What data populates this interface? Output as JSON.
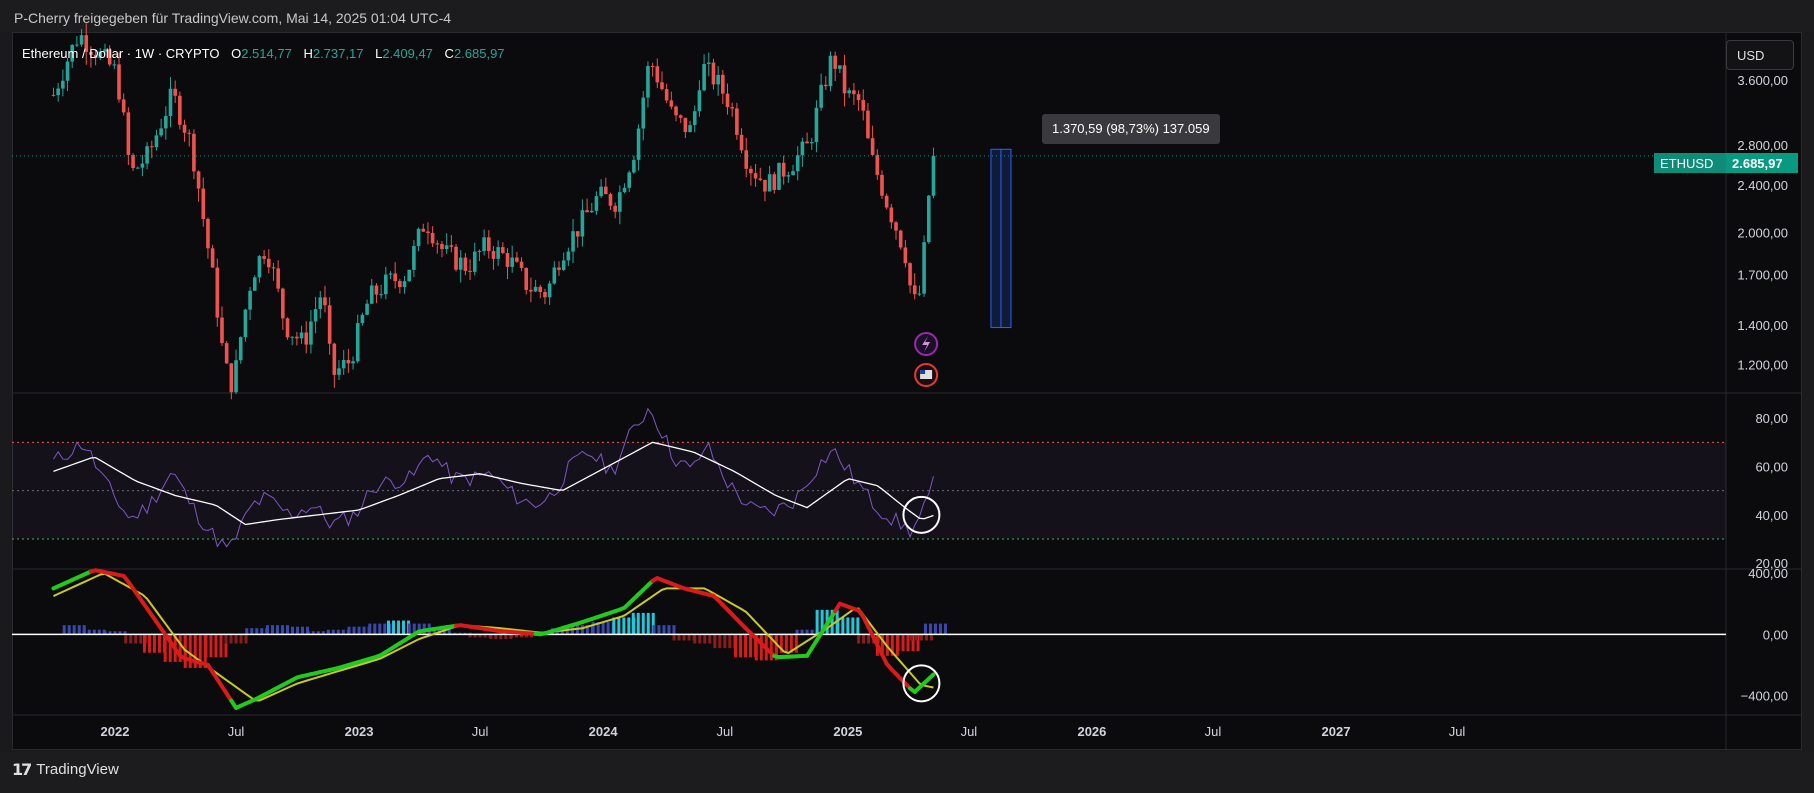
{
  "header": {
    "text": "P-Cherry freigegeben für TradingView.com, Mai 14, 2025 01:04 UTC-4"
  },
  "footer": {
    "brand": "TradingView",
    "logo_mark": "17"
  },
  "legend": {
    "title": "Ethereum / Dollar · 1W · CRYPTO",
    "o_label": "O",
    "o_value": "2.514,77",
    "h_label": "H",
    "h_value": "2.737,17",
    "l_label": "L",
    "l_value": "2.409,47",
    "c_label": "C",
    "c_value": "2.685,97"
  },
  "currency_button": "USD",
  "last_price": {
    "symbol": "ETHUSD",
    "value": "2.685,97",
    "numeric": 2685.97
  },
  "measure_tooltip": "1.370,59 (98,73%) 137.059",
  "colors": {
    "up": "#26a69a",
    "down": "#ef5350",
    "rsi": "#7e57c2",
    "rsi_ma": "#ffffff",
    "macd": "#22c91e",
    "signal": "#c8c828",
    "macd_down": "#d81b1b"
  },
  "chart_data": [
    {
      "type": "candlestick",
      "pane": "price",
      "scale": "log",
      "ylim": [
        1080,
        4300
      ],
      "y_ticks": [
        {
          "value": 3600,
          "label": "3.600,00"
        },
        {
          "value": 2800,
          "label": "2.800,00"
        },
        {
          "value": 2400,
          "label": "2.400,00"
        },
        {
          "value": 2000,
          "label": "2.000,00"
        },
        {
          "value": 1700,
          "label": "1.700,00"
        },
        {
          "value": 1400,
          "label": "1.400,00"
        },
        {
          "value": 1200,
          "label": "1.200,00"
        }
      ],
      "x_ticks": [
        "2022",
        "Jul",
        "2023",
        "Jul",
        "2024",
        "Jul",
        "2025",
        "Jul",
        "2026",
        "Jul",
        "2027",
        "Jul"
      ],
      "x_range": [
        "2021-10",
        "2027-09"
      ],
      "close_path": [
        [
          "2021-10-01",
          3400
        ],
        [
          "2021-11-08",
          4300
        ],
        [
          "2021-12-06",
          4000
        ],
        [
          "2022-01-03",
          3700
        ],
        [
          "2022-01-24",
          2500
        ],
        [
          "2022-02-21",
          2700
        ],
        [
          "2022-03-28",
          3400
        ],
        [
          "2022-04-25",
          2800
        ],
        [
          "2022-05-16",
          2000
        ],
        [
          "2022-06-13",
          1200
        ],
        [
          "2022-06-27",
          1100
        ],
        [
          "2022-07-25",
          1700
        ],
        [
          "2022-08-15",
          1900
        ],
        [
          "2022-09-12",
          1400
        ],
        [
          "2022-10-10",
          1300
        ],
        [
          "2022-11-07",
          1600
        ],
        [
          "2022-11-21",
          1150
        ],
        [
          "2022-12-19",
          1220
        ],
        [
          "2023-01-16",
          1550
        ],
        [
          "2023-02-13",
          1650
        ],
        [
          "2023-03-13",
          1700
        ],
        [
          "2023-04-10",
          2100
        ],
        [
          "2023-05-08",
          1850
        ],
        [
          "2023-06-12",
          1750
        ],
        [
          "2023-07-10",
          1900
        ],
        [
          "2023-08-14",
          1800
        ],
        [
          "2023-09-11",
          1620
        ],
        [
          "2023-10-09",
          1580
        ],
        [
          "2023-10-30",
          1850
        ],
        [
          "2023-11-27",
          2050
        ],
        [
          "2023-12-25",
          2300
        ],
        [
          "2024-01-22",
          2250
        ],
        [
          "2024-02-19",
          2800
        ],
        [
          "2024-03-11",
          3900
        ],
        [
          "2024-04-15",
          3100
        ],
        [
          "2024-05-13",
          2950
        ],
        [
          "2024-05-27",
          3800
        ],
        [
          "2024-06-17",
          3600
        ],
        [
          "2024-07-08",
          3300
        ],
        [
          "2024-08-05",
          2600
        ],
        [
          "2024-09-02",
          2400
        ],
        [
          "2024-10-07",
          2600
        ],
        [
          "2024-11-04",
          2800
        ],
        [
          "2024-12-09",
          3950
        ],
        [
          "2024-12-30",
          3400
        ],
        [
          "2025-01-20",
          3300
        ],
        [
          "2025-02-03",
          2700
        ],
        [
          "2025-03-03",
          2200
        ],
        [
          "2025-03-31",
          1800
        ],
        [
          "2025-04-07",
          1500
        ],
        [
          "2025-04-21",
          1600
        ],
        [
          "2025-05-05",
          2500
        ],
        [
          "2025-05-12",
          2685.97
        ]
      ],
      "measure": {
        "from": 1385,
        "to": 2756,
        "label": "1.370,59 (98,73%) 137.059"
      },
      "last": 2685.97
    },
    {
      "type": "line",
      "pane": "rsi",
      "ylim": [
        18,
        90
      ],
      "y_ticks": [
        {
          "value": 80,
          "label": "80,00"
        },
        {
          "value": 60,
          "label": "60,00"
        },
        {
          "value": 40,
          "label": "40,00"
        },
        {
          "value": 20,
          "label": "20,00"
        }
      ],
      "bands": {
        "upper": 70,
        "middle": 50,
        "lower": 30
      },
      "series": [
        {
          "name": "",
          "values": [
            [
              "2021-10-01",
              62
            ],
            [
              "2021-11-15",
              70
            ],
            [
              "2021-12-20",
              52
            ],
            [
              "2022-01-24",
              38
            ],
            [
              "2022-02-21",
              44
            ],
            [
              "2022-03-28",
              58
            ],
            [
              "2022-04-25",
              44
            ],
            [
              "2022-05-23",
              33
            ],
            [
              "2022-06-20",
              25
            ],
            [
              "2022-07-25",
              44
            ],
            [
              "2022-08-15",
              47
            ],
            [
              "2022-09-19",
              40
            ],
            [
              "2022-10-24",
              44
            ],
            [
              "2022-11-21",
              36
            ],
            [
              "2022-12-26",
              40
            ],
            [
              "2023-01-23",
              52
            ],
            [
              "2023-02-20",
              54
            ],
            [
              "2023-03-20",
              55
            ],
            [
              "2023-04-17",
              66
            ],
            [
              "2023-05-22",
              55
            ],
            [
              "2023-06-19",
              55
            ],
            [
              "2023-07-17",
              57
            ],
            [
              "2023-08-21",
              48
            ],
            [
              "2023-09-18",
              44
            ],
            [
              "2023-10-16",
              48
            ],
            [
              "2023-11-13",
              60
            ],
            [
              "2023-12-11",
              66
            ],
            [
              "2024-01-15",
              58
            ],
            [
              "2024-02-12",
              74
            ],
            [
              "2024-03-11",
              85
            ],
            [
              "2024-04-15",
              64
            ],
            [
              "2024-05-13",
              58
            ],
            [
              "2024-06-03",
              69
            ],
            [
              "2024-07-08",
              52
            ],
            [
              "2024-08-12",
              42
            ],
            [
              "2024-09-09",
              41
            ],
            [
              "2024-10-14",
              46
            ],
            [
              "2024-11-11",
              58
            ],
            [
              "2024-12-09",
              67
            ],
            [
              "2025-01-13",
              54
            ],
            [
              "2025-02-10",
              44
            ],
            [
              "2025-03-10",
              38
            ],
            [
              "2025-04-07",
              33
            ],
            [
              "2025-04-28",
              44
            ],
            [
              "2025-05-12",
              55
            ]
          ]
        },
        {
          "name": "",
          "values": [
            [
              "2021-10-01",
              58
            ],
            [
              "2021-12-01",
              64
            ],
            [
              "2022-02-01",
              54
            ],
            [
              "2022-04-01",
              48
            ],
            [
              "2022-06-01",
              44
            ],
            [
              "2022-07-15",
              36
            ],
            [
              "2022-09-01",
              38
            ],
            [
              "2022-11-01",
              40
            ],
            [
              "2023-01-01",
              42
            ],
            [
              "2023-03-01",
              48
            ],
            [
              "2023-05-01",
              55
            ],
            [
              "2023-07-01",
              57
            ],
            [
              "2023-09-01",
              53
            ],
            [
              "2023-11-01",
              50
            ],
            [
              "2024-01-01",
              59
            ],
            [
              "2024-03-15",
              70
            ],
            [
              "2024-05-15",
              66
            ],
            [
              "2024-07-15",
              58
            ],
            [
              "2024-09-15",
              48
            ],
            [
              "2024-11-01",
              43
            ],
            [
              "2025-01-01",
              55
            ],
            [
              "2025-02-15",
              52
            ],
            [
              "2025-04-01",
              42
            ],
            [
              "2025-04-21",
              38
            ],
            [
              "2025-05-12",
              40
            ]
          ]
        }
      ]
    },
    {
      "type": "line+histogram",
      "pane": "macd",
      "ylim": [
        -520,
        420
      ],
      "y_ticks": [
        {
          "value": 400,
          "label": "400,00"
        },
        {
          "value": 0,
          "label": "0,00"
        },
        {
          "value": -400,
          "label": "−400,00"
        }
      ],
      "series": [
        {
          "name": "",
          "values": [
            [
              "2021-10-01",
              300
            ],
            [
              "2021-12-01",
              420
            ],
            [
              "2022-01-15",
              380
            ],
            [
              "2022-03-01",
              100
            ],
            [
              "2022-04-10",
              -150
            ],
            [
              "2022-05-20",
              -200
            ],
            [
              "2022-07-01",
              -480
            ],
            [
              "2022-08-01",
              -420
            ],
            [
              "2022-10-01",
              -280
            ],
            [
              "2022-12-01",
              -220
            ],
            [
              "2023-02-01",
              -140
            ],
            [
              "2023-04-01",
              20
            ],
            [
              "2023-06-01",
              60
            ],
            [
              "2023-08-01",
              20
            ],
            [
              "2023-10-01",
              0
            ],
            [
              "2023-12-01",
              80
            ],
            [
              "2024-02-01",
              170
            ],
            [
              "2024-03-20",
              370
            ],
            [
              "2024-05-01",
              300
            ],
            [
              "2024-06-15",
              250
            ],
            [
              "2024-08-01",
              40
            ],
            [
              "2024-09-15",
              -150
            ],
            [
              "2024-11-01",
              -140
            ],
            [
              "2024-12-20",
              200
            ],
            [
              "2025-01-20",
              150
            ],
            [
              "2025-03-01",
              -200
            ],
            [
              "2025-04-10",
              -380
            ],
            [
              "2025-05-12",
              -250
            ]
          ]
        },
        {
          "name": "",
          "values": [
            [
              "2021-10-01",
              250
            ],
            [
              "2021-12-15",
              400
            ],
            [
              "2022-02-15",
              250
            ],
            [
              "2022-04-15",
              -100
            ],
            [
              "2022-06-01",
              -250
            ],
            [
              "2022-08-01",
              -440
            ],
            [
              "2022-10-01",
              -320
            ],
            [
              "2022-12-01",
              -240
            ],
            [
              "2023-02-01",
              -160
            ],
            [
              "2023-04-01",
              -30
            ],
            [
              "2023-06-01",
              60
            ],
            [
              "2023-08-01",
              40
            ],
            [
              "2023-10-01",
              10
            ],
            [
              "2023-12-01",
              40
            ],
            [
              "2024-02-01",
              120
            ],
            [
              "2024-04-01",
              300
            ],
            [
              "2024-06-01",
              300
            ],
            [
              "2024-08-01",
              150
            ],
            [
              "2024-10-01",
              -130
            ],
            [
              "2024-12-01",
              40
            ],
            [
              "2025-01-15",
              180
            ],
            [
              "2025-03-01",
              -80
            ],
            [
              "2025-04-20",
              -330
            ],
            [
              "2025-05-12",
              -350
            ]
          ]
        }
      ],
      "histogram": [
        [
          "2021-11-01",
          60
        ],
        [
          "2021-12-01",
          30
        ],
        [
          "2022-01-01",
          20
        ],
        [
          "2022-02-01",
          -60
        ],
        [
          "2022-03-01",
          -120
        ],
        [
          "2022-04-01",
          -180
        ],
        [
          "2022-05-01",
          -220
        ],
        [
          "2022-06-01",
          -150
        ],
        [
          "2022-07-01",
          -60
        ],
        [
          "2022-08-01",
          40
        ],
        [
          "2022-09-01",
          60
        ],
        [
          "2022-10-01",
          50
        ],
        [
          "2022-11-01",
          20
        ],
        [
          "2022-12-01",
          30
        ],
        [
          "2023-01-01",
          50
        ],
        [
          "2023-02-01",
          70
        ],
        [
          "2023-03-01",
          90
        ],
        [
          "2023-04-01",
          70
        ],
        [
          "2023-05-01",
          30
        ],
        [
          "2023-06-01",
          10
        ],
        [
          "2023-07-01",
          -20
        ],
        [
          "2023-08-01",
          -30
        ],
        [
          "2023-09-01",
          -20
        ],
        [
          "2023-10-01",
          10
        ],
        [
          "2023-11-01",
          40
        ],
        [
          "2023-12-01",
          60
        ],
        [
          "2024-01-01",
          80
        ],
        [
          "2024-02-01",
          110
        ],
        [
          "2024-03-01",
          140
        ],
        [
          "2024-04-01",
          60
        ],
        [
          "2024-05-01",
          -40
        ],
        [
          "2024-06-01",
          -60
        ],
        [
          "2024-07-01",
          -90
        ],
        [
          "2024-08-01",
          -150
        ],
        [
          "2024-09-01",
          -170
        ],
        [
          "2024-10-01",
          -120
        ],
        [
          "2024-11-01",
          30
        ],
        [
          "2024-12-01",
          160
        ],
        [
          "2025-01-01",
          110
        ],
        [
          "2025-02-01",
          -60
        ],
        [
          "2025-03-01",
          -140
        ],
        [
          "2025-04-01",
          -110
        ],
        [
          "2025-04-21",
          -40
        ],
        [
          "2025-05-12",
          70
        ]
      ]
    }
  ]
}
